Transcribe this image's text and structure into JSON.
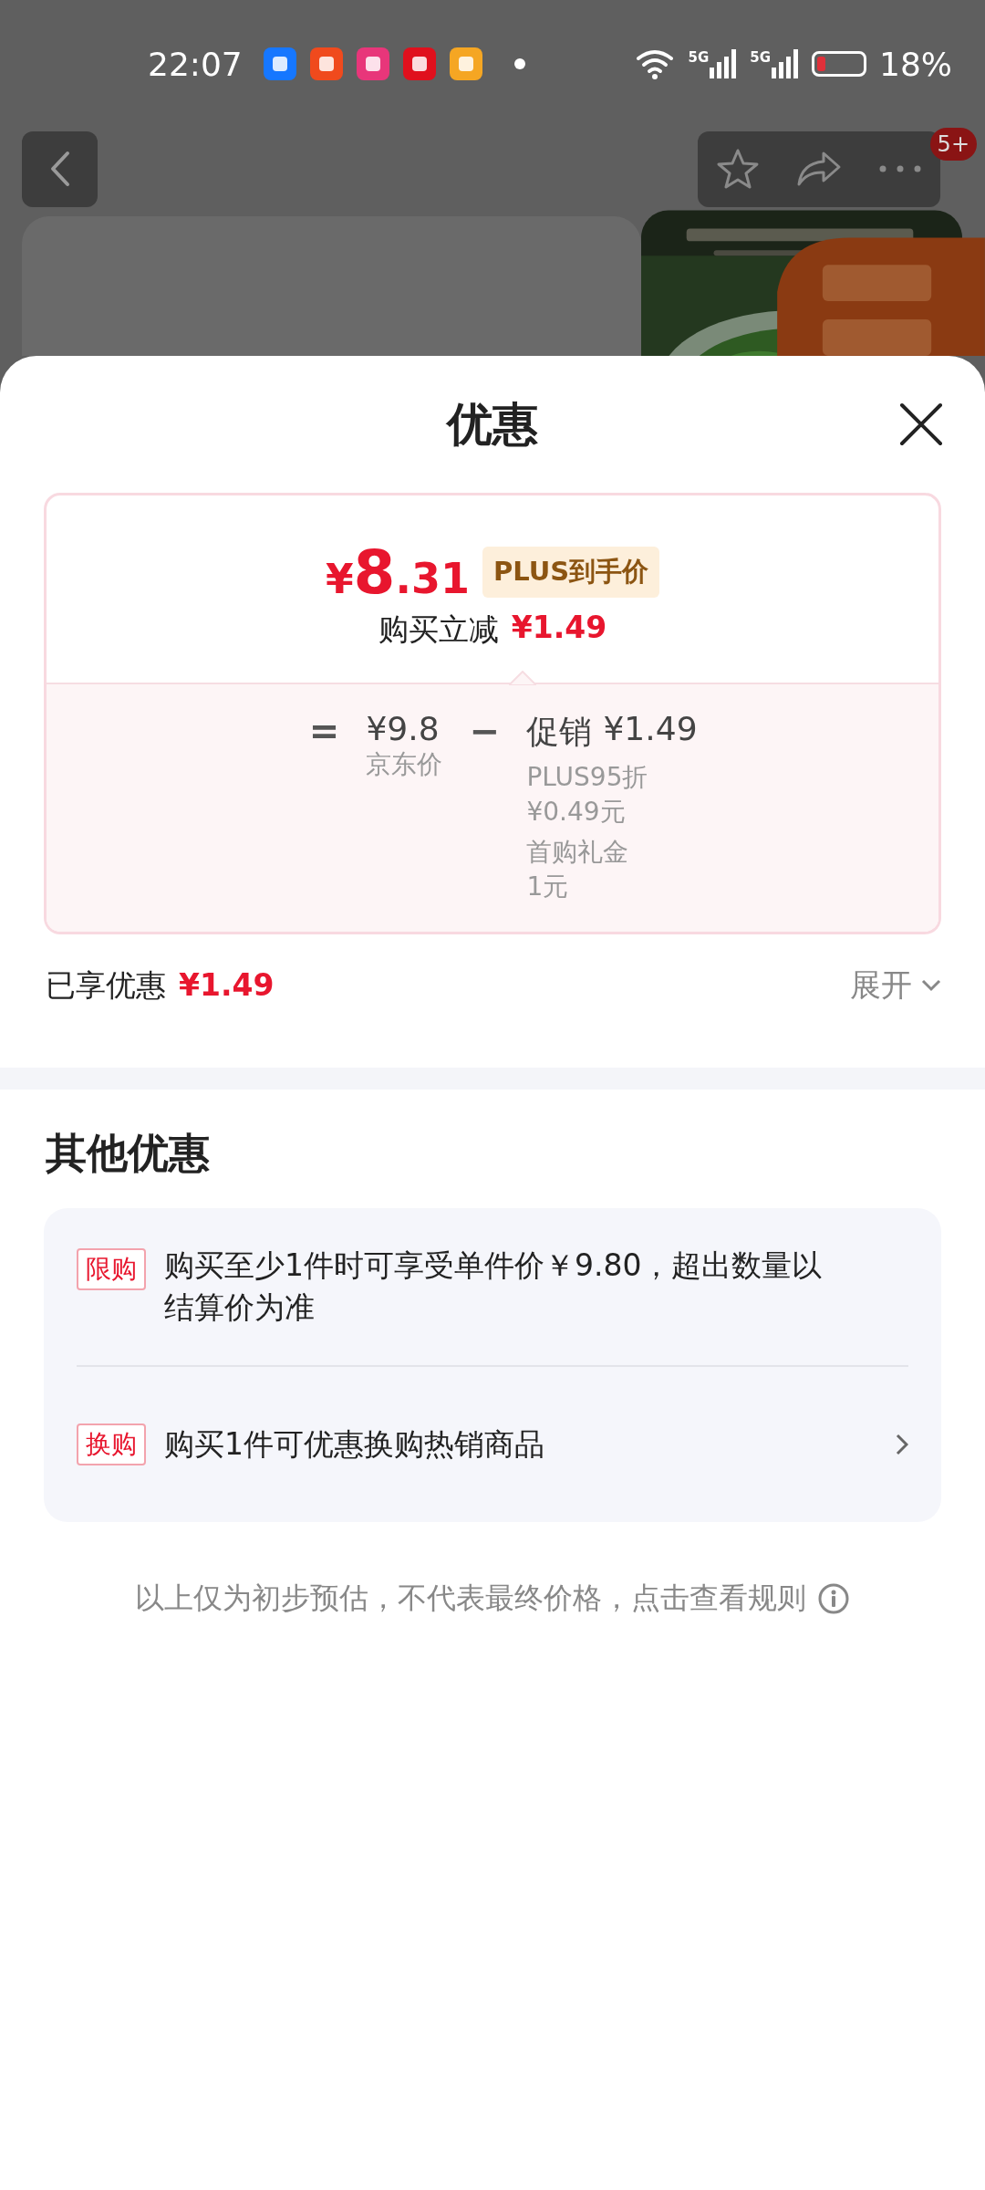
{
  "status_bar": {
    "time": "22:07",
    "network": [
      "5G",
      "5G"
    ],
    "battery": "18%"
  },
  "nav": {
    "notification_badge": "5+"
  },
  "sheet": {
    "title": "优惠",
    "price": {
      "symbol": "¥",
      "integer": "8",
      "fraction": ".31",
      "tag": "PLUS到手价"
    },
    "instant_discount": {
      "label": "购买立减",
      "amount": "¥1.49"
    },
    "breakdown": {
      "equals": "=",
      "base": {
        "amount": "¥9.8",
        "label": "京东价"
      },
      "minus": "−",
      "discount": {
        "label": "促销",
        "amount": "¥1.49",
        "items": [
          {
            "name": "PLUS95折",
            "amount": "¥0.49元"
          },
          {
            "name": "首购礼金",
            "amount": "1元"
          }
        ]
      }
    },
    "enjoyed": {
      "label": "已享优惠",
      "amount": "¥1.49",
      "expand": "展开",
      "expanded": false
    },
    "other": {
      "title": "其他优惠",
      "offers": [
        {
          "tag": "限购",
          "text": "购买至少1件时可享受单件价￥9.80，超出数量以结算价为准",
          "navigable": false
        },
        {
          "tag": "换购",
          "text": "购买1件可优惠换购热销商品",
          "navigable": true
        }
      ]
    },
    "footer_note": "以上仅为初步预估，不代表最终价格，点击查看规则"
  }
}
